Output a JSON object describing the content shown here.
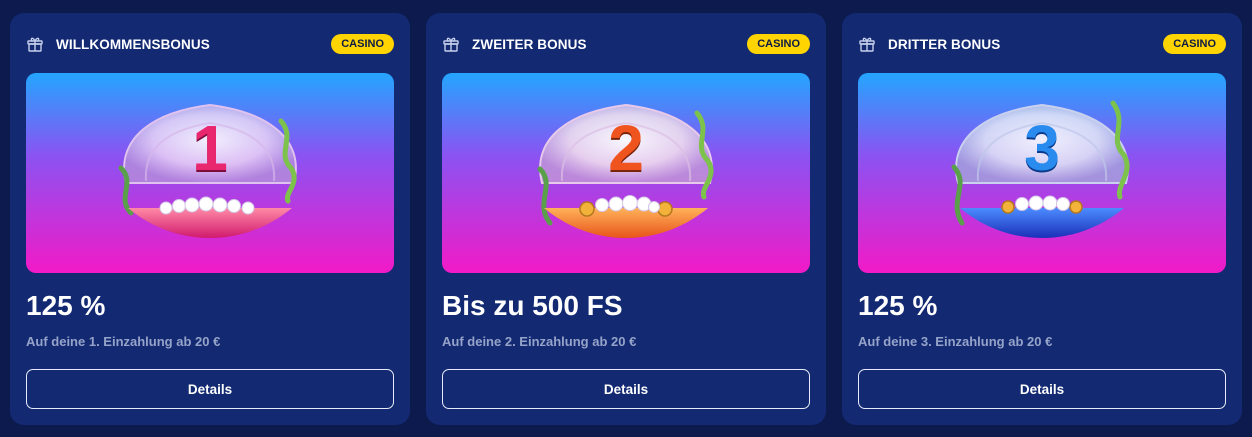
{
  "colors": {
    "page_bg": "#0c1a4e",
    "card_bg": "#132a73",
    "badge_bg": "#ffd400",
    "subtext": "#96a3c9"
  },
  "cards": [
    {
      "icon": "gift-icon",
      "title": "WILLKOMMENSBONUS",
      "badge": "CASINO",
      "number": "1",
      "headline": "125 %",
      "subtitle": "Auf deine 1. Einzahlung ab 20 €",
      "button": "Details"
    },
    {
      "icon": "gift-icon",
      "title": "ZWEITER BONUS",
      "badge": "CASINO",
      "number": "2",
      "headline": "Bis zu 500 FS",
      "subtitle": "Auf deine 2. Einzahlung ab 20 €",
      "button": "Details"
    },
    {
      "icon": "gift-icon",
      "title": "DRITTER BONUS",
      "badge": "CASINO",
      "number": "3",
      "headline": "125 %",
      "subtitle": "Auf deine 3. Einzahlung ab 20 €",
      "button": "Details"
    }
  ]
}
